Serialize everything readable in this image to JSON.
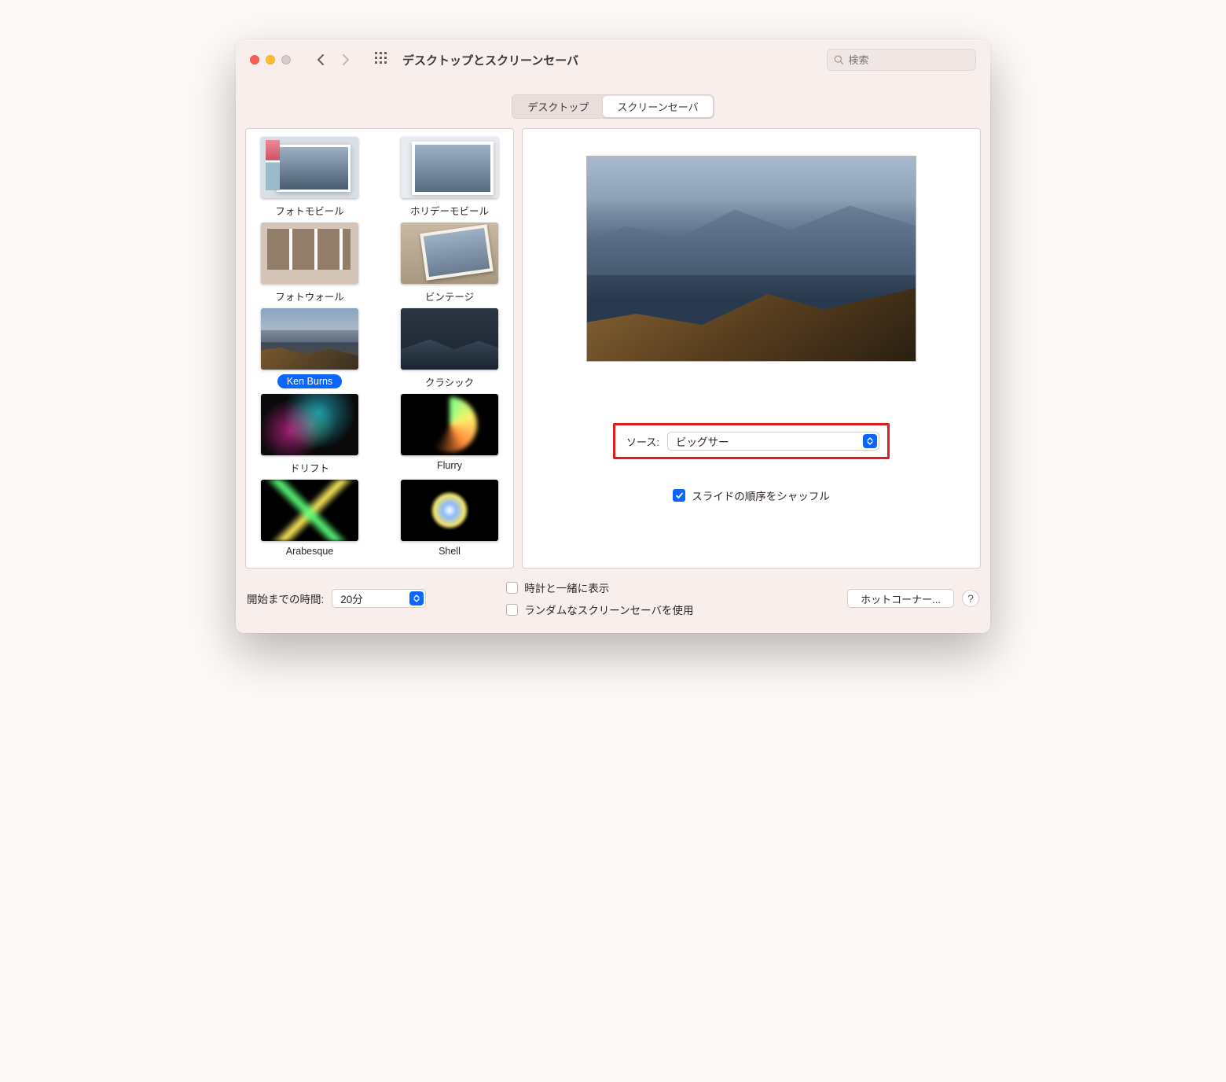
{
  "window": {
    "title": "デスクトップとスクリーンセーバ",
    "search_placeholder": "検索"
  },
  "tabs": {
    "desktop": "デスクトップ",
    "screensaver": "スクリーンセーバ",
    "active": "screensaver"
  },
  "screensavers": [
    {
      "id": "photo-mobile",
      "label": "フォトモビール",
      "selected": false
    },
    {
      "id": "holiday-mobile",
      "label": "ホリデーモビール",
      "selected": false
    },
    {
      "id": "photo-wall",
      "label": "フォトウォール",
      "selected": false
    },
    {
      "id": "vintage",
      "label": "ビンテージ",
      "selected": false
    },
    {
      "id": "ken-burns",
      "label": "Ken Burns",
      "selected": true
    },
    {
      "id": "classic",
      "label": "クラシック",
      "selected": false
    },
    {
      "id": "drift",
      "label": "ドリフト",
      "selected": false
    },
    {
      "id": "flurry",
      "label": "Flurry",
      "selected": false
    },
    {
      "id": "arabesque",
      "label": "Arabesque",
      "selected": false
    },
    {
      "id": "shell",
      "label": "Shell",
      "selected": false
    }
  ],
  "preview": {
    "source_label": "ソース:",
    "source_value": "ビッグサー",
    "shuffle_label": "スライドの順序をシャッフル",
    "shuffle_checked": true
  },
  "bottom": {
    "start_label": "開始までの時間:",
    "start_value": "20分",
    "show_clock_label": "時計と一緒に表示",
    "show_clock_checked": false,
    "random_label": "ランダムなスクリーンセーバを使用",
    "random_checked": false,
    "hot_corners_label": "ホットコーナー...",
    "help": "?"
  }
}
